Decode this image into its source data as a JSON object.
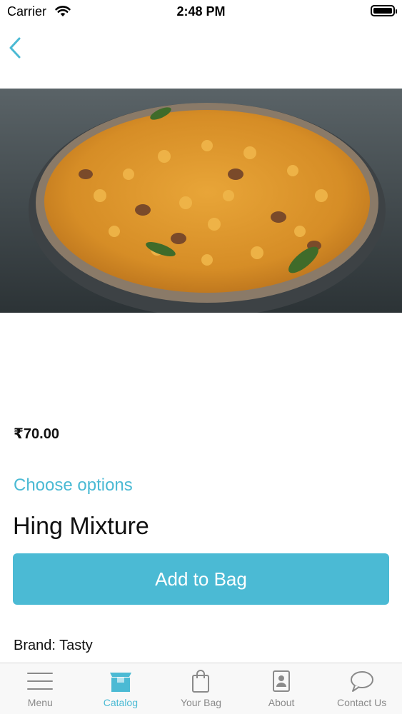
{
  "status_bar": {
    "carrier": "Carrier",
    "time": "2:48 PM"
  },
  "product": {
    "price": "₹70.00",
    "choose_options": "Choose options",
    "title": "Hing Mixture",
    "add_to_bag": "Add to Bag",
    "brand": "Brand: Tasty"
  },
  "tab_bar": {
    "items": [
      {
        "label": "Menu",
        "icon": "hamburger-menu-icon"
      },
      {
        "label": "Catalog",
        "icon": "catalog-box-icon",
        "active": true
      },
      {
        "label": "Your Bag",
        "icon": "shopping-bag-icon"
      },
      {
        "label": "About",
        "icon": "about-contact-card-icon"
      },
      {
        "label": "Contact Us",
        "icon": "chat-bubble-icon"
      }
    ]
  },
  "colors": {
    "accent": "#4bbad4",
    "inactive": "#8a8a8a"
  }
}
